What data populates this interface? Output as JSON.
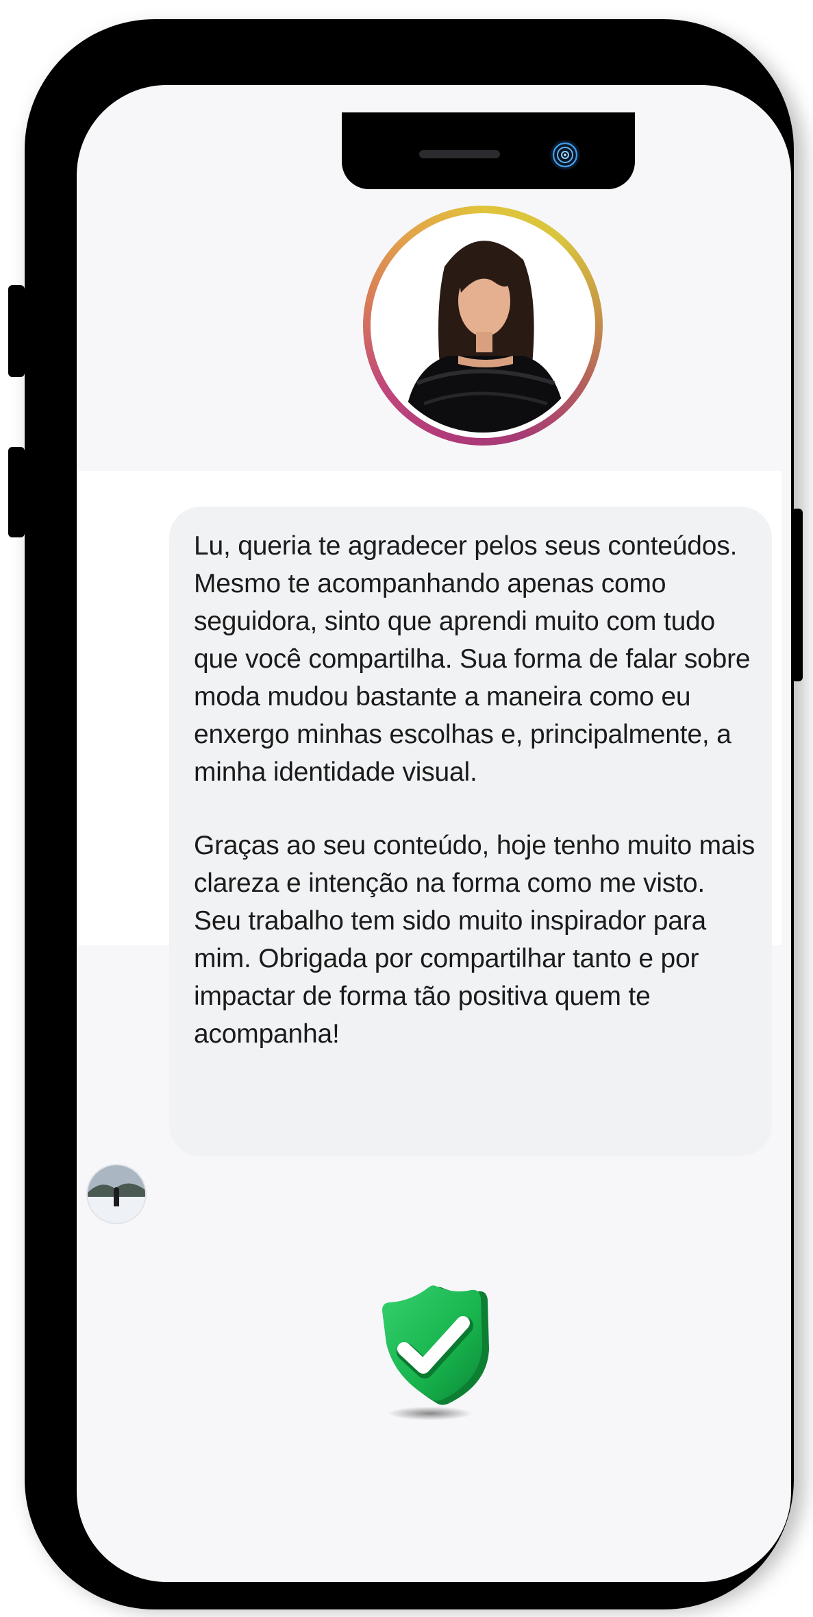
{
  "message": {
    "paragraphs": [
      "Lu, queria te agradecer pelos seus conteúdos. Mesmo te acompanhando apenas como seguidora, sinto que aprendi muito com tudo que você compartilha. Sua forma de falar sobre moda mudou bastante a maneira como eu enxergo minhas escolhas e, principalmente, a minha identidade visual.",
      "Graças ao seu conteúdo, hoje tenho muito mais clareza e intenção na forma como me visto. Seu trabalho tem sido muito inspirador para mim. Obrigada por compartilhar tanto e por impactar de forma tão positiva quem te acompanha!"
    ]
  },
  "icons": {
    "profile": "profile-avatar-icon",
    "sender": "sender-avatar-icon",
    "verified": "verified-shield-check-icon",
    "camera": "front-camera-icon"
  },
  "colors": {
    "ring_start": "#b03a7a",
    "ring_end": "#e0c33a",
    "bubble": "#f1f2f4",
    "shield_green": "#17b34d",
    "screen_bg": "#f7f7f9"
  }
}
